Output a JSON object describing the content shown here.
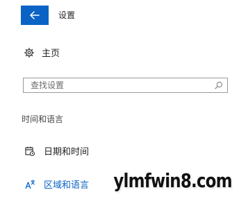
{
  "header": {
    "title": "设置",
    "back_icon": "back-arrow-icon"
  },
  "home": {
    "label": "主页",
    "icon": "gear-icon"
  },
  "search": {
    "placeholder": "查找设置",
    "icon": "search-icon"
  },
  "section": {
    "heading": "时间和语言"
  },
  "nav": {
    "items": [
      {
        "label": "日期和时间",
        "icon": "date-time-icon",
        "selected": false
      },
      {
        "label": "区域和语言",
        "icon": "language-icon",
        "selected": true
      }
    ]
  },
  "watermark": {
    "text": "ylmfwin8.com"
  },
  "colors": {
    "accent": "#0b63c5",
    "background": "#ffffff",
    "text": "#1a1a1a"
  }
}
